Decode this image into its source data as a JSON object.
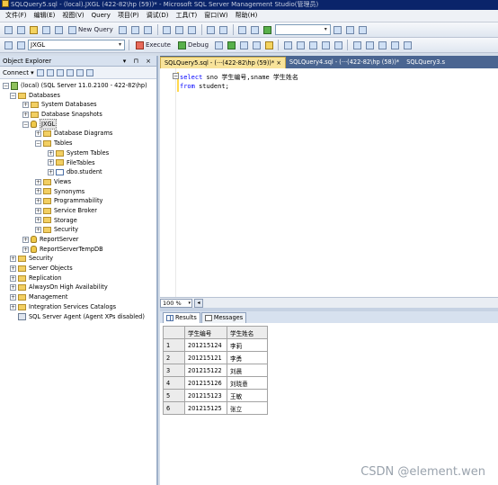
{
  "window": {
    "title": "SQLQuery5.sql - (local).JXGL (422-82\\hp (59))* - Microsoft SQL Server Management Studio(管理员)"
  },
  "menu": [
    "文件(F)",
    "编辑(E)",
    "视图(V)",
    "Query",
    "项目(P)",
    "调试(D)",
    "工具(T)",
    "窗口(W)",
    "帮助(H)"
  ],
  "toolbar": {
    "new_query": "New Query",
    "database": "JXGL",
    "execute": "Execute",
    "debug": "Debug"
  },
  "object_explorer": {
    "title": "Object Explorer",
    "header_controls": "▾ ⊓ ×",
    "connect": "Connect ▾",
    "nodes": [
      {
        "label": "(local) (SQL Server 11.0.2100 - 422-82\\hp)",
        "level": 0,
        "expander": "−",
        "icon": "server-icon"
      },
      {
        "label": "Databases",
        "level": 1,
        "expander": "−",
        "icon": "folder-icon"
      },
      {
        "label": "System Databases",
        "level": 2,
        "expander": "+",
        "icon": "folder-icon"
      },
      {
        "label": "Database Snapshots",
        "level": 2,
        "expander": "+",
        "icon": "folder-icon"
      },
      {
        "label": "JXGL",
        "level": 2,
        "expander": "−",
        "icon": "database-icon",
        "selected": true
      },
      {
        "label": "Database Diagrams",
        "level": 3,
        "expander": "+",
        "icon": "folder-icon"
      },
      {
        "label": "Tables",
        "level": 3,
        "expander": "−",
        "icon": "folder-icon"
      },
      {
        "label": "System Tables",
        "level": 4,
        "expander": "+",
        "icon": "folder-icon"
      },
      {
        "label": "FileTables",
        "level": 4,
        "expander": "+",
        "icon": "folder-icon"
      },
      {
        "label": "dbo.student",
        "level": 4,
        "expander": "+",
        "icon": "table-icon"
      },
      {
        "label": "Views",
        "level": 3,
        "expander": "+",
        "icon": "folder-icon"
      },
      {
        "label": "Synonyms",
        "level": 3,
        "expander": "+",
        "icon": "folder-icon"
      },
      {
        "label": "Programmability",
        "level": 3,
        "expander": "+",
        "icon": "folder-icon"
      },
      {
        "label": "Service Broker",
        "level": 3,
        "expander": "+",
        "icon": "folder-icon"
      },
      {
        "label": "Storage",
        "level": 3,
        "expander": "+",
        "icon": "folder-icon"
      },
      {
        "label": "Security",
        "level": 3,
        "expander": "+",
        "icon": "folder-icon"
      },
      {
        "label": "ReportServer",
        "level": 2,
        "expander": "+",
        "icon": "database-icon"
      },
      {
        "label": "ReportServerTempDB",
        "level": 2,
        "expander": "+",
        "icon": "database-icon"
      },
      {
        "label": "Security",
        "level": 1,
        "expander": "+",
        "icon": "folder-icon"
      },
      {
        "label": "Server Objects",
        "level": 1,
        "expander": "+",
        "icon": "folder-icon"
      },
      {
        "label": "Replication",
        "level": 1,
        "expander": "+",
        "icon": "folder-icon"
      },
      {
        "label": "AlwaysOn High Availability",
        "level": 1,
        "expander": "+",
        "icon": "folder-icon"
      },
      {
        "label": "Management",
        "level": 1,
        "expander": "+",
        "icon": "folder-icon"
      },
      {
        "label": "Integration Services Catalogs",
        "level": 1,
        "expander": "+",
        "icon": "folder-icon"
      },
      {
        "label": "SQL Server Agent (Agent XPs disabled)",
        "level": 1,
        "expander": "",
        "icon": "agent-icon"
      }
    ]
  },
  "document_tabs": [
    {
      "label": "SQLQuery5.sql - (···(422-82\\hp (59))* ×",
      "active": true
    },
    {
      "label": "SQLQuery4.sql - (···(422-82\\hp (58))*",
      "active": false
    },
    {
      "label": "SQLQuery3.s",
      "active": false
    }
  ],
  "editor": {
    "fold_marker": "−",
    "lines": [
      {
        "keyword": "select",
        "text": " sno 学生编号,sname 学生姓名"
      },
      {
        "keyword": "from",
        "text": " student;"
      }
    ]
  },
  "status": {
    "zoom": "100 %",
    "zoom_arrow": "▾",
    "scroll_left": "◂"
  },
  "results": {
    "tabs": [
      "Results",
      "Messages"
    ],
    "columns": [
      "学生编号",
      "学生姓名"
    ],
    "rows": [
      {
        "num": "1",
        "cells": [
          "201215124",
          "李莉"
        ]
      },
      {
        "num": "2",
        "cells": [
          "201215121",
          "李勇"
        ]
      },
      {
        "num": "3",
        "cells": [
          "201215122",
          "刘晨"
        ]
      },
      {
        "num": "4",
        "cells": [
          "201215126",
          "刘晓意"
        ]
      },
      {
        "num": "5",
        "cells": [
          "201215123",
          "王敏"
        ]
      },
      {
        "num": "6",
        "cells": [
          "201215125",
          "张立"
        ]
      }
    ]
  },
  "watermark": "CSDN @element.wen"
}
